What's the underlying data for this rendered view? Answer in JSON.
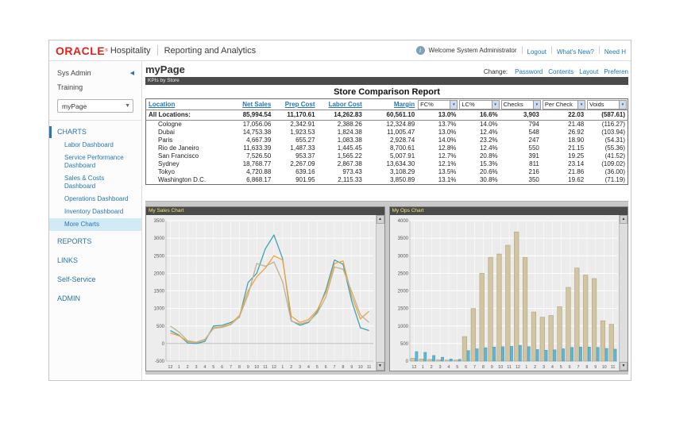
{
  "colors": {
    "oracle_red": "#e2231a",
    "link_blue": "#2577b5",
    "portlet_bar_dark": "#4b4b4b",
    "chart_title_yellow": "#f5e76f",
    "active_item_bg": "#d2e9f6",
    "chart_bg": "#ececec"
  },
  "header": {
    "brand": "ORACLE",
    "registered": "®",
    "product": "Hospitality",
    "app": "Reporting and Analytics",
    "welcome": "Welcome System Administrator",
    "links": [
      "Logout",
      "What's New?",
      "Need H"
    ]
  },
  "page": {
    "title": "myPage",
    "change_label": "Change:",
    "change_links": [
      "Password",
      "Contents",
      "Layout",
      "Preferen"
    ]
  },
  "sidebar": {
    "org": "Sys Admin",
    "role": "Training",
    "page_select": "myPage",
    "charts_section": "CHARTS",
    "chart_items": [
      {
        "label": "Labor Dashboard",
        "active": false
      },
      {
        "label": "Service Performance Dashboard",
        "active": false
      },
      {
        "label": "Sales & Costs Dashboard",
        "active": false
      },
      {
        "label": "Operations Dashboard",
        "active": false
      },
      {
        "label": "Inventory Dashboard",
        "active": false
      },
      {
        "label": "More Charts",
        "active": true
      }
    ],
    "nav_items": [
      "REPORTS",
      "LINKS",
      "Self-Service",
      "ADMIN"
    ]
  },
  "report": {
    "portlet_label": "KPIs by Store",
    "title": "Store Comparison Report",
    "columns": [
      "Location",
      "Net Sales",
      "Prep Cost",
      "Labor Cost",
      "Margin"
    ],
    "filters": [
      "FC%",
      "LC%",
      "Checks",
      "Per Check",
      "Voids"
    ],
    "totals": {
      "label": "All Locations:",
      "values": [
        "85,994.54",
        "11,170.61",
        "14,262.83",
        "60,561.10",
        "13.0%",
        "16.6%",
        "3,903",
        "22.03",
        "(587.61)"
      ]
    },
    "rows": [
      {
        "name": "Cologne",
        "values": [
          "17,056.06",
          "2,342.91",
          "2,388.26",
          "12,324.89",
          "13.7%",
          "14.0%",
          "794",
          "21.48",
          "(116.27)"
        ]
      },
      {
        "name": "Dubai",
        "values": [
          "14,753.38",
          "1,923.53",
          "1,824.38",
          "11,005.47",
          "13.0%",
          "12.4%",
          "548",
          "26.92",
          "(103.94)"
        ]
      },
      {
        "name": "Paris",
        "values": [
          "4,667.39",
          "655.27",
          "1,083.38",
          "2,928.74",
          "14.0%",
          "23.2%",
          "247",
          "18.90",
          "(54.31)"
        ]
      },
      {
        "name": "Rio de Janeiro",
        "values": [
          "11,633.39",
          "1,487.33",
          "1,445.45",
          "8,700.61",
          "12.8%",
          "12.4%",
          "550",
          "21.15",
          "(55.36)"
        ]
      },
      {
        "name": "San Francisco",
        "values": [
          "7,526.50",
          "953.37",
          "1,565.22",
          "5,007.91",
          "12.7%",
          "20.8%",
          "391",
          "19.25",
          "(41.52)"
        ]
      },
      {
        "name": "Sydney",
        "values": [
          "18,768.77",
          "2,267.09",
          "2,867.38",
          "13,634.30",
          "12.1%",
          "15.3%",
          "811",
          "23.14",
          "(109.02)"
        ]
      },
      {
        "name": "Tokyo",
        "values": [
          "4,720.88",
          "639.16",
          "973.43",
          "3,108.29",
          "13.5%",
          "20.6%",
          "216",
          "21.86",
          "(36.00)"
        ]
      },
      {
        "name": "Washington D.C.",
        "values": [
          "6,868.17",
          "901.95",
          "2,115.33",
          "3,850.89",
          "13.1%",
          "30.8%",
          "350",
          "19.62",
          "(71.19)"
        ]
      }
    ]
  },
  "chart_data": [
    {
      "type": "line",
      "title": "My Sales Chart",
      "x": [
        "12",
        "1",
        "2",
        "3",
        "4",
        "5",
        "6",
        "7",
        "8",
        "9",
        "10",
        "11",
        "12",
        "1",
        "2",
        "3",
        "4",
        "5",
        "6",
        "7",
        "8",
        "9",
        "10",
        "11"
      ],
      "ylim": [
        -500,
        3500
      ],
      "ytick_step": 500,
      "grid": true,
      "legend": "none",
      "series": [
        {
          "name": "series-teal",
          "color": "#3fa3b6",
          "values": [
            370,
            240,
            20,
            0,
            60,
            500,
            520,
            600,
            750,
            1740,
            2000,
            2700,
            3090,
            2420,
            650,
            520,
            600,
            900,
            1520,
            2380,
            2260,
            1210,
            450,
            370
          ]
        },
        {
          "name": "series-orange",
          "color": "#efa33c",
          "values": [
            300,
            220,
            60,
            30,
            100,
            450,
            480,
            560,
            800,
            1500,
            1900,
            2150,
            2500,
            2380,
            780,
            600,
            680,
            950,
            1450,
            2280,
            2350,
            1350,
            700,
            920
          ]
        },
        {
          "name": "series-tan",
          "color": "#bfb292",
          "values": [
            500,
            330,
            80,
            40,
            120,
            430,
            460,
            540,
            760,
            1380,
            2280,
            2200,
            2320,
            1760,
            640,
            560,
            620,
            860,
            1320,
            2180,
            2120,
            1480,
            820,
            600
          ]
        }
      ]
    },
    {
      "type": "bar",
      "title": "My Ops Chart",
      "x": [
        "12",
        "1",
        "2",
        "3",
        "4",
        "5",
        "6",
        "7",
        "8",
        "9",
        "10",
        "11",
        "12",
        "1",
        "2",
        "3",
        "4",
        "5",
        "6",
        "7",
        "8",
        "9",
        "10",
        "11"
      ],
      "ylim": [
        0,
        4000
      ],
      "ytick_step": 500,
      "grid": true,
      "legend": "none",
      "series": [
        {
          "name": "series-tan",
          "color": "#d2c5a2",
          "border": "#a89a72",
          "values": [
            80,
            60,
            50,
            40,
            30,
            30,
            700,
            1500,
            2500,
            2950,
            3050,
            3300,
            3680,
            2950,
            1400,
            1250,
            1300,
            1550,
            2100,
            2650,
            2450,
            2350,
            1150,
            1050
          ]
        },
        {
          "name": "series-blue",
          "color": "#5fb6d9",
          "border": "#3f94b8",
          "values": [
            270,
            250,
            160,
            110,
            60,
            50,
            300,
            350,
            380,
            400,
            410,
            420,
            450,
            410,
            330,
            310,
            320,
            350,
            390,
            400,
            400,
            390,
            360,
            340
          ]
        }
      ]
    }
  ]
}
